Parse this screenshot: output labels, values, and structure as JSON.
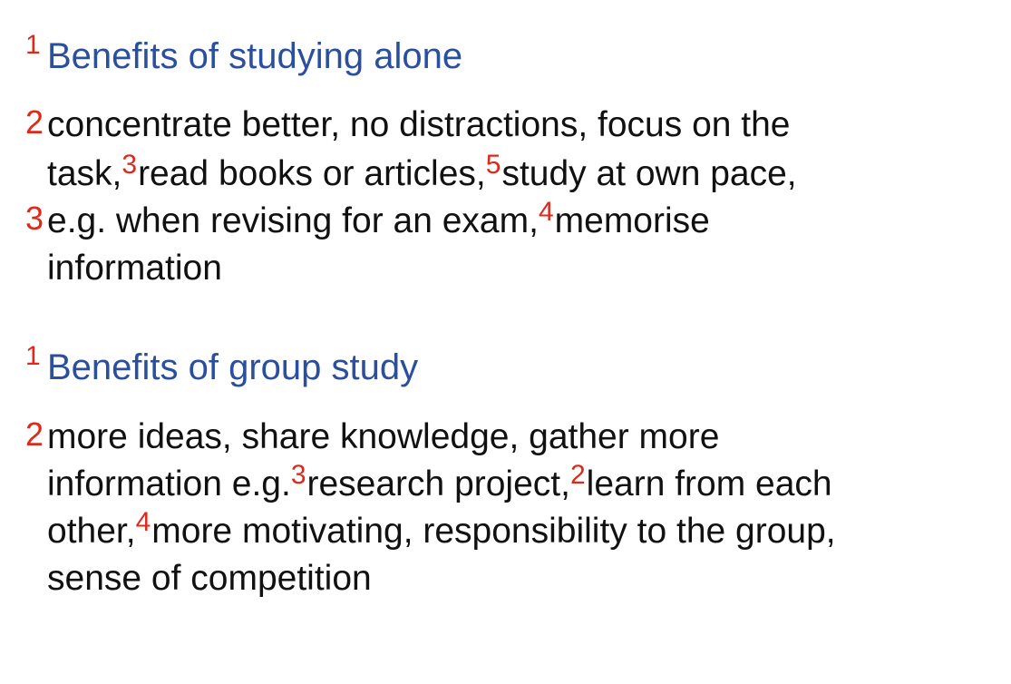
{
  "sections": [
    {
      "heading_num": "1",
      "heading": "Benefits of studying alone",
      "lines": [
        {
          "n1": "2",
          "t1": "concentrate better, no distractions, focus on the"
        },
        {
          "t1": "task,",
          "n2": "3",
          "t2": "read books or articles,",
          "n3": "5",
          "t3": "study at own pace,"
        },
        {
          "n1": "3",
          "t1": "e.g. when revising for an exam,",
          "n2": "4",
          "t2": "memorise"
        },
        {
          "t1": "information"
        }
      ]
    },
    {
      "heading_num": "1",
      "heading": "Benefits of group study",
      "lines": [
        {
          "n1": "2",
          "t1": "more ideas, share knowledge, gather more"
        },
        {
          "t1": "information e.g.",
          "n2": "3",
          "t2": "research project,",
          "n3": "2",
          "t3": "learn from each"
        },
        {
          "t1": "other,",
          "n2": "4",
          "t2": "more motivating, responsibility to the group,"
        },
        {
          "t1": "sense of competition"
        }
      ]
    }
  ],
  "colors": {
    "heading": "#2a4f9e",
    "number": "#e0281a",
    "text": "#111111"
  }
}
